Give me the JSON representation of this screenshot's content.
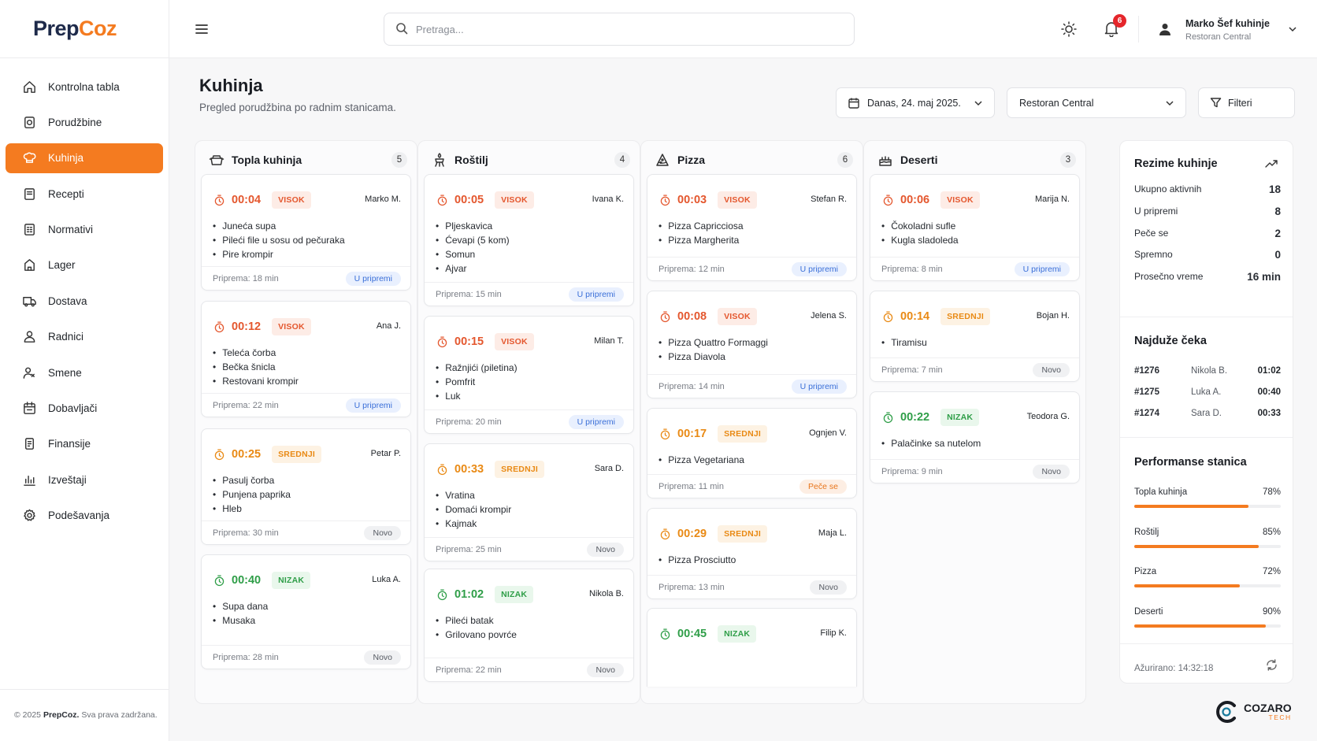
{
  "brand": {
    "part1": "Prep",
    "part2": "Coz"
  },
  "sidebar": {
    "items": [
      {
        "label": "Kontrolna tabla",
        "icon": "home-icon"
      },
      {
        "label": "Porudžbine",
        "icon": "orders-icon"
      },
      {
        "label": "Kuhinja",
        "icon": "chef-hat-icon",
        "active": true
      },
      {
        "label": "Recepti",
        "icon": "recipes-icon"
      },
      {
        "label": "Normativi",
        "icon": "norms-icon"
      },
      {
        "label": "Lager",
        "icon": "inventory-icon"
      },
      {
        "label": "Dostava",
        "icon": "truck-icon"
      },
      {
        "label": "Radnici",
        "icon": "worker-icon"
      },
      {
        "label": "Smene",
        "icon": "shifts-icon"
      },
      {
        "label": "Dobavljači",
        "icon": "suppliers-icon"
      },
      {
        "label": "Finansije",
        "icon": "finance-icon"
      },
      {
        "label": "Izveštaji",
        "icon": "reports-icon"
      },
      {
        "label": "Podešavanja",
        "icon": "settings-icon"
      }
    ],
    "footer_prefix": "© 2025",
    "footer_brand": "PrepCoz.",
    "footer_suffix": "Sva prava zadržana."
  },
  "topbar": {
    "search_placeholder": "Pretraga...",
    "notifications_count": "6",
    "user_name": "Marko Šef kuhinje",
    "user_restaurant": "Restoran Central"
  },
  "page": {
    "title": "Kuhinja",
    "subtitle": "Pregled porudžbina po radnim stanicama.",
    "date_filter": "Danas, 24. maj 2025.",
    "restaurant_filter": "Restoran Central",
    "filters_label": "Filteri"
  },
  "columns": [
    {
      "name": "Topla kuhinja",
      "count": "5",
      "icon": "pot-icon",
      "cards": [
        {
          "time": "00:04",
          "priority": "VISOK",
          "chef": "Marko M.",
          "items": [
            "Juneća supa",
            "Pileći file u sosu od pečuraka",
            "Pire krompir"
          ],
          "prep": "Priprema: 18 min",
          "status": "U pripremi"
        },
        {
          "time": "00:12",
          "priority": "VISOK",
          "chef": "Ana J.",
          "items": [
            "Teleća čorba",
            "Bečka šnicla",
            "Restovani krompir"
          ],
          "prep": "Priprema: 22 min",
          "status": "U pripremi"
        },
        {
          "time": "00:25",
          "priority": "SREDNJI",
          "chef": "Petar P.",
          "items": [
            "Pasulj čorba",
            "Punjena paprika",
            "Hleb"
          ],
          "prep": "Priprema: 30 min",
          "status": "Novo"
        },
        {
          "time": "00:40",
          "priority": "NIZAK",
          "chef": "Luka A.",
          "items": [
            "Supa dana",
            "Musaka"
          ],
          "prep": "Priprema: 28 min",
          "status": "Novo"
        }
      ]
    },
    {
      "name": "Roštilj",
      "count": "4",
      "icon": "grill-icon",
      "cards": [
        {
          "time": "00:05",
          "priority": "VISOK",
          "chef": "Ivana K.",
          "items": [
            "Pljeskavica",
            "Ćevapi (5 kom)",
            "Somun",
            "Ajvar"
          ],
          "prep": "Priprema: 15 min",
          "status": "U pripremi"
        },
        {
          "time": "00:15",
          "priority": "VISOK",
          "chef": "Milan T.",
          "items": [
            "Ražnjići (piletina)",
            "Pomfrit",
            "Luk"
          ],
          "prep": "Priprema: 20 min",
          "status": "U pripremi"
        },
        {
          "time": "00:33",
          "priority": "SREDNJI",
          "chef": "Sara D.",
          "items": [
            "Vratina",
            "Domaći krompir",
            "Kajmak"
          ],
          "prep": "Priprema: 25 min",
          "status": "Novo"
        },
        {
          "time": "01:02",
          "priority": "NIZAK",
          "chef": "Nikola B.",
          "items": [
            "Pileći batak",
            "Grilovano povrće"
          ],
          "prep": "Priprema: 22 min",
          "status": "Novo"
        }
      ]
    },
    {
      "name": "Pizza",
      "count": "6",
      "icon": "pizza-icon",
      "cards": [
        {
          "time": "00:03",
          "priority": "VISOK",
          "chef": "Stefan R.",
          "items": [
            "Pizza Capricciosa",
            "Pizza Margherita"
          ],
          "prep": "Priprema: 12 min",
          "status": "U pripremi"
        },
        {
          "time": "00:08",
          "priority": "VISOK",
          "chef": "Jelena S.",
          "items": [
            "Pizza Quattro Formaggi",
            "Pizza Diavola"
          ],
          "prep": "Priprema: 14 min",
          "status": "U pripremi"
        },
        {
          "time": "00:17",
          "priority": "SREDNJI",
          "chef": "Ognjen V.",
          "items": [
            "Pizza Vegetariana"
          ],
          "prep": "Priprema: 11 min",
          "status": "Peče se"
        },
        {
          "time": "00:29",
          "priority": "SREDNJI",
          "chef": "Maja L.",
          "items": [
            "Pizza Prosciutto"
          ],
          "prep": "Priprema: 13 min",
          "status": "Novo"
        },
        {
          "time": "00:45",
          "priority": "NIZAK",
          "chef": "Filip K.",
          "items": [],
          "prep": "",
          "status": ""
        }
      ]
    },
    {
      "name": "Deserti",
      "count": "3",
      "icon": "cake-icon",
      "cards": [
        {
          "time": "00:06",
          "priority": "VISOK",
          "chef": "Marija N.",
          "items": [
            "Čokoladni sufle",
            "Kugla sladoleda"
          ],
          "prep": "Priprema: 8 min",
          "status": "U pripremi"
        },
        {
          "time": "00:14",
          "priority": "SREDNJI",
          "chef": "Bojan H.",
          "items": [
            "Tiramisu"
          ],
          "prep": "Priprema: 7 min",
          "status": "Novo"
        },
        {
          "time": "00:22",
          "priority": "NIZAK",
          "chef": "Teodora G.",
          "items": [
            "Palačinke sa nutelom"
          ],
          "prep": "Priprema: 9 min",
          "status": "Novo"
        }
      ]
    }
  ],
  "summary": {
    "title": "Rezime kuhinje",
    "rows": [
      {
        "label": "Ukupno aktivnih",
        "value": "18"
      },
      {
        "label": "U pripremi",
        "value": "8"
      },
      {
        "label": "Peče se",
        "value": "2"
      },
      {
        "label": "Spremno",
        "value": "0"
      },
      {
        "label": "Prosečno vreme",
        "value": "16 min"
      }
    ],
    "waiting_title": "Najduže čeka",
    "waiting": [
      {
        "order": "#1276",
        "name": "Nikola B.",
        "time": "01:02"
      },
      {
        "order": "#1275",
        "name": "Luka A.",
        "time": "00:40"
      },
      {
        "order": "#1274",
        "name": "Sara D.",
        "time": "00:33"
      }
    ],
    "perf_title": "Performanse stanica",
    "performance": [
      {
        "station": "Topla kuhinja",
        "percent_label": "78%",
        "value": 78
      },
      {
        "station": "Roštilj",
        "percent_label": "85%",
        "value": 85
      },
      {
        "station": "Pizza",
        "percent_label": "72%",
        "value": 72
      },
      {
        "station": "Deserti",
        "percent_label": "90%",
        "value": 90
      }
    ],
    "updated": "Ažurirano: 14:32:18"
  },
  "footer_logo": {
    "title": "COZARO",
    "sub": "TECH"
  },
  "colors": {
    "accent": "#f47b20",
    "visok": "#e4572e",
    "srednji": "#e98a15",
    "nizak": "#2f9e48",
    "status_in_progress": "#3a6fd8",
    "badge": "#e5262b"
  }
}
